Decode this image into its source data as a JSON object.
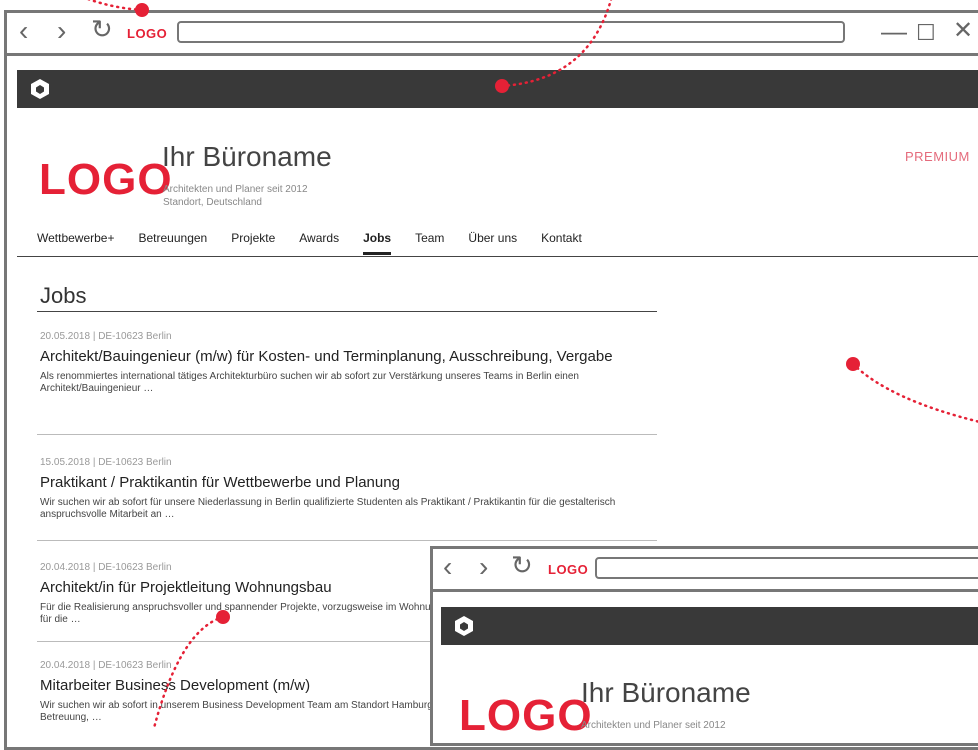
{
  "browser": {
    "back_icon": "chevron-left",
    "forward_icon": "chevron-right",
    "reload_icon": "reload",
    "logo_label": "LOGO",
    "window_controls": [
      "minimize",
      "maximize",
      "close"
    ]
  },
  "site": {
    "logo": "LOGO",
    "name": "Ihr Büroname",
    "tagline": "Architekten und Planer seit 2012",
    "location": "Standort, Deutschland",
    "premium": "PREMIUM"
  },
  "menu": {
    "items": [
      "Wettbewerbe+",
      "Betreuungen",
      "Projekte",
      "Awards",
      "Jobs",
      "Team",
      "Über uns",
      "Kontakt"
    ],
    "active": "Jobs"
  },
  "page": {
    "title": "Jobs"
  },
  "jobs": [
    {
      "meta": "20.05.2018 | DE-10623 Berlin",
      "title": "Architekt/Bauingenieur (m/w) für Kosten- und Terminplanung, Ausschreibung, Vergabe",
      "desc": "Als renommiertes international tätiges Architekturbüro suchen wir ab sofort zur Verstärkung unseres Teams in Berlin einen Architekt/Bauingenieur …"
    },
    {
      "meta": "15.05.2018 | DE-10623 Berlin",
      "title": "Praktikant / Praktikantin für Wettbewerbe und Planung",
      "desc": "Wir suchen wir ab sofort für unsere Niederlassung in Berlin qualifizierte Studenten als Praktikant / Praktikantin für die gestalterisch anspruchsvolle Mitarbeit an …"
    },
    {
      "meta": "20.04.2018 | DE-10623 Berlin",
      "title": "Architekt/in für Projektleitung Wohnungsbau",
      "desc": "Für die Realisierung anspruchsvoller und spannender Projekte, vorzugsweise im Wohnungsbau, suchen wir bald möglichsten Architekt/in für die …"
    },
    {
      "meta": "20.04.2018 | DE-10623 Berlin",
      "title": "Mitarbeiter Business Development (m/w)",
      "desc": "Wir suchen wir ab sofort in unserem Business Development Team am Standort Hamburg tatkräftige Unterstützung für die organisatorische Betreuung, …"
    }
  ],
  "second_window": {
    "logo_label": "LOGO",
    "site_logo": "LOGO",
    "site_name": "Ihr Büroname",
    "tagline": "Architekten und Planer seit 2012"
  },
  "colors": {
    "accent": "#e52136",
    "premium": "#e56b7c",
    "topbar": "#393939",
    "window_border": "#777777"
  }
}
